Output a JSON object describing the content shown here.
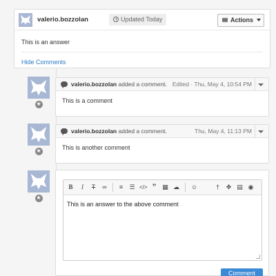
{
  "answer": {
    "author": "valerio.bozzolan",
    "updated_label": "Updated Today",
    "actions_label": "Actions",
    "body": "This is an answer",
    "hide_comments_label": "Hide Comments"
  },
  "comments": [
    {
      "author": "valerio.bozzolan",
      "action": "added a comment.",
      "time": "Edited · Thu, May 4, 10:54 PM",
      "text": "This is a comment"
    },
    {
      "author": "valerio.bozzolan",
      "action": "added a comment.",
      "time": "Thu, May 4, 11:13 PM",
      "text": "This is another comment"
    }
  ],
  "editor": {
    "toolbar": [
      "bold-icon",
      "italic-icon",
      "strikethrough-icon",
      "link-icon",
      "unordered-list-icon",
      "ordered-list-icon",
      "code-icon",
      "quote-icon",
      "table-icon",
      "upload-icon",
      "emoji-icon",
      "pin-icon",
      "fullscreen-icon",
      "help-book-icon",
      "preview-eye-icon"
    ],
    "value": "This is an answer to the above comment",
    "submit_label": "Comment"
  },
  "colors": {
    "link": "#2a7ac6",
    "primary_button": "#3a8ad6",
    "avatar": "#a8b7d3"
  }
}
